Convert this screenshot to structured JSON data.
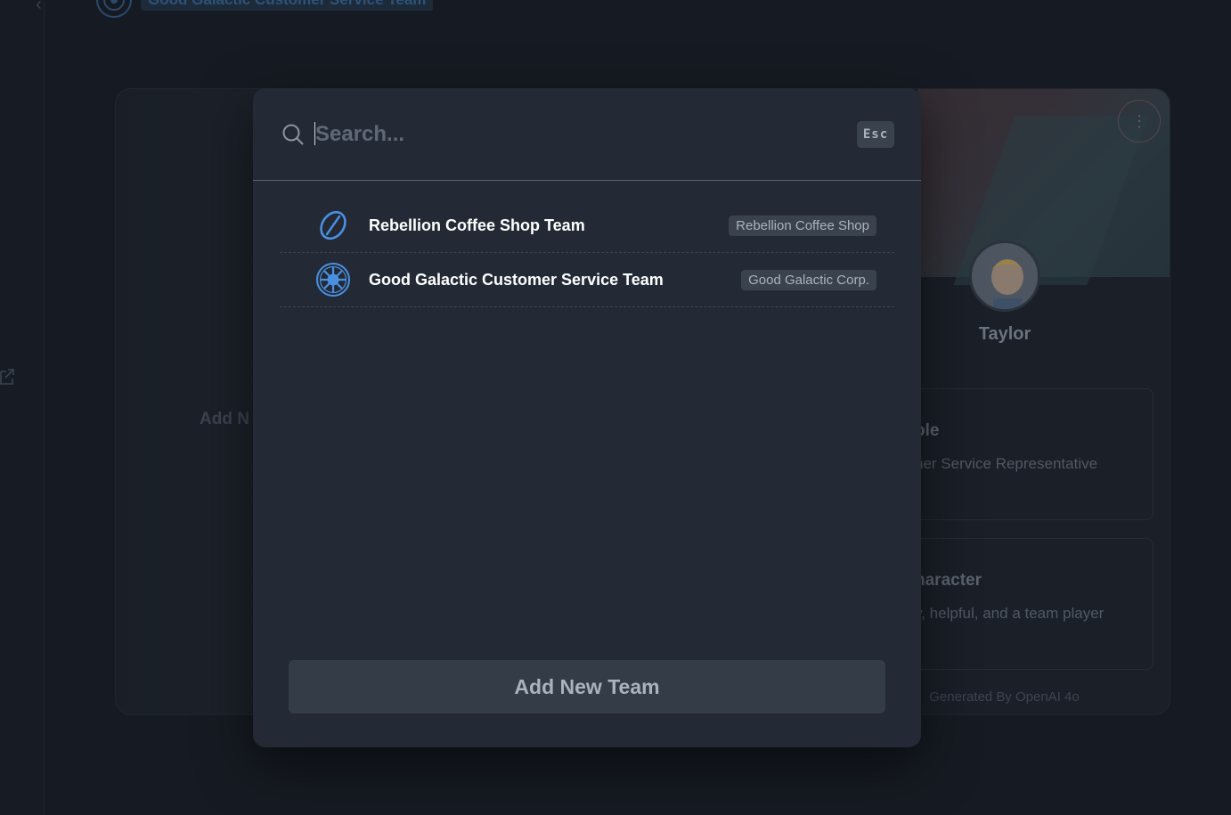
{
  "background": {
    "breadcrumb_team": "Good Galactic Customer Service Team",
    "add_new_label": "Add N",
    "profile": {
      "name": "Taylor",
      "role_title": "ole",
      "role_text": "ner Service Representative",
      "character_title": "haracter",
      "character_text": "y, helpful, and a team player",
      "footer": "Generated By OpenAI 4o"
    }
  },
  "modal": {
    "search": {
      "placeholder": "Search...",
      "value": "",
      "esc_label": "Esc"
    },
    "results": [
      {
        "title": "Rebellion Coffee Shop Team",
        "tag": "Rebellion Coffee Shop",
        "icon": "coffee-bean-icon"
      },
      {
        "title": "Good Galactic Customer Service Team",
        "tag": "Good Galactic Corp.",
        "icon": "galactic-emblem-icon"
      }
    ],
    "add_button_label": "Add New Team"
  },
  "colors": {
    "accent_blue": "#4a90e2",
    "modal_bg": "#232a35",
    "page_bg": "#161b23"
  }
}
